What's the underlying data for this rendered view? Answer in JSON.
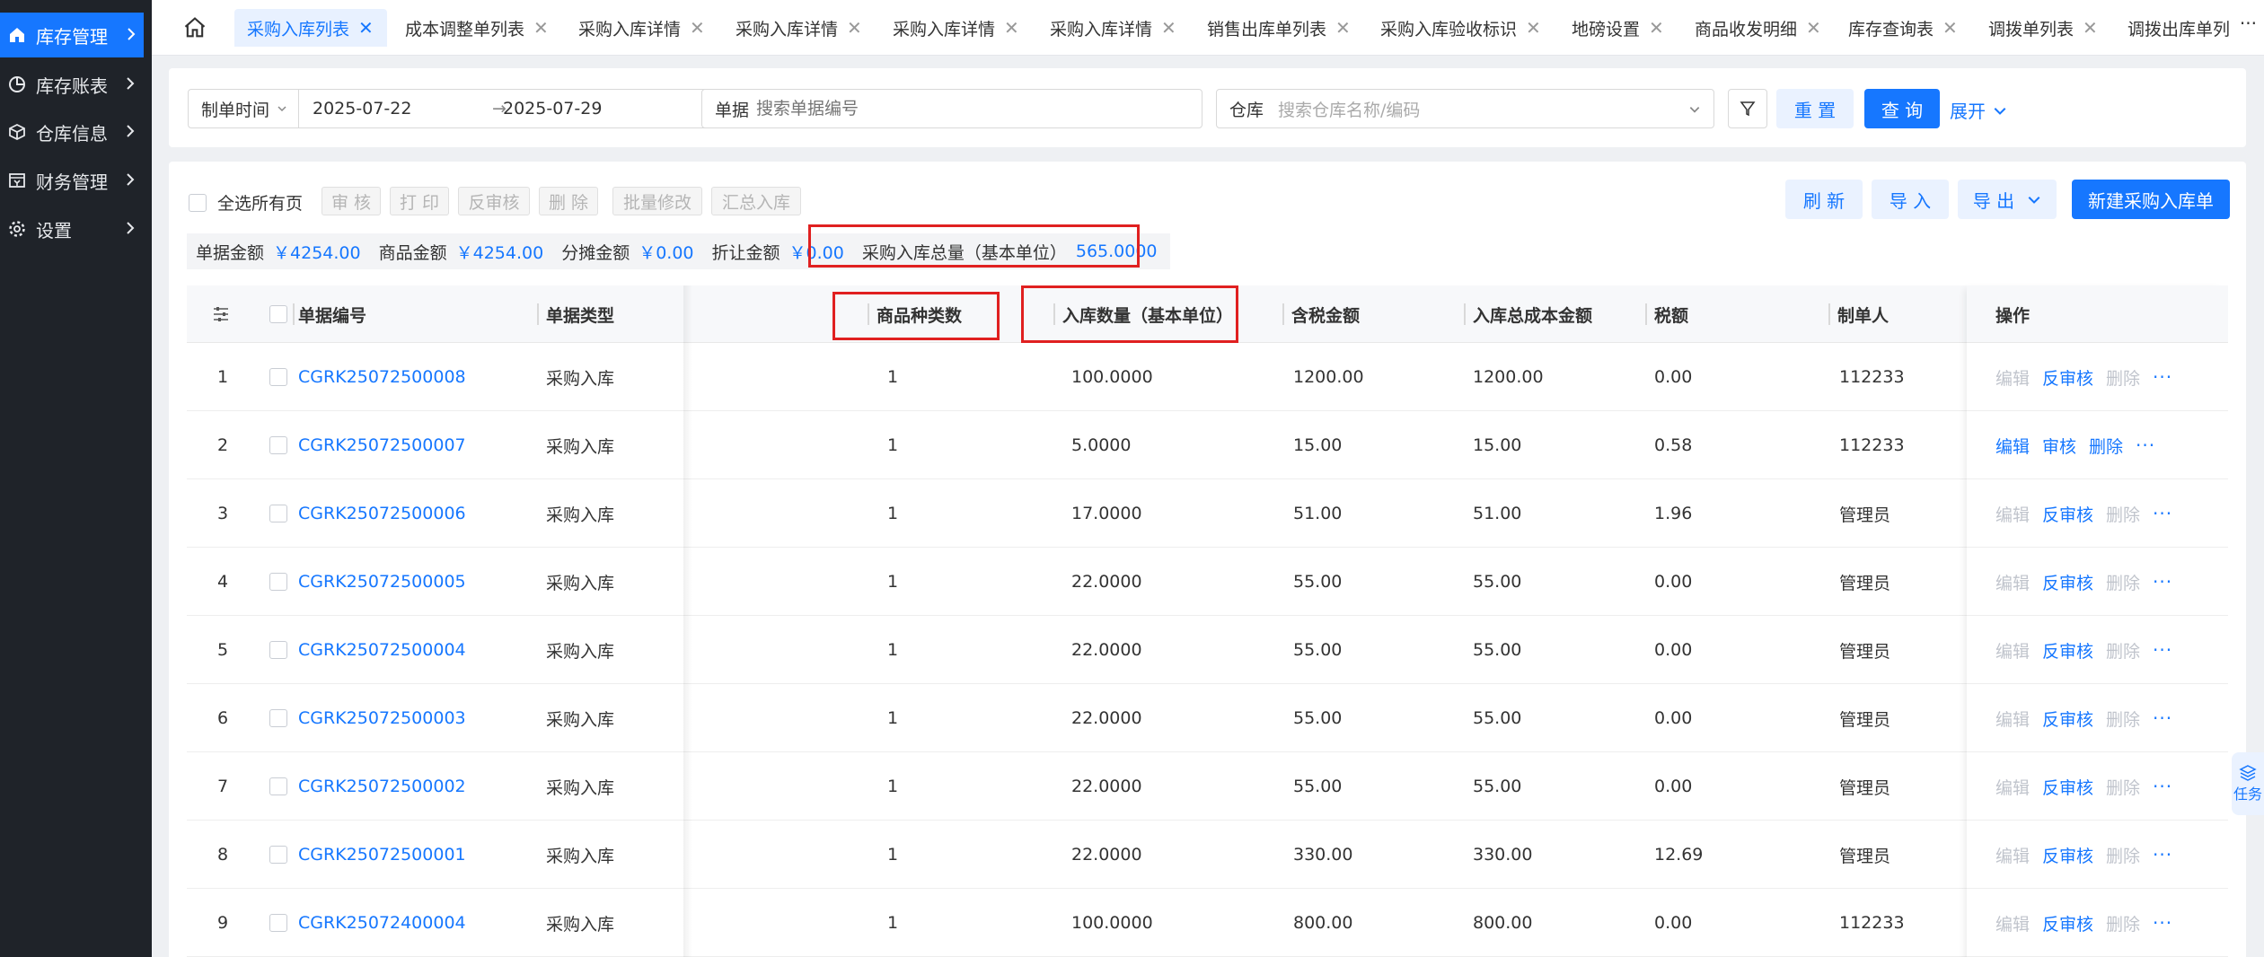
{
  "sidebar": {
    "items": [
      {
        "label": "库存管理",
        "icon": "home-icon",
        "active": true
      },
      {
        "label": "库存账表",
        "icon": "pie-chart-icon"
      },
      {
        "label": "仓库信息",
        "icon": "cube-icon"
      },
      {
        "label": "财务管理",
        "icon": "finance-icon"
      },
      {
        "label": "设置",
        "icon": "gear-icon"
      }
    ]
  },
  "tabs": [
    {
      "label": "采购入库列表",
      "active": true
    },
    {
      "label": "成本调整单列表"
    },
    {
      "label": "采购入库详情"
    },
    {
      "label": "采购入库详情"
    },
    {
      "label": "采购入库详情"
    },
    {
      "label": "采购入库详情"
    },
    {
      "label": "销售出库单列表"
    },
    {
      "label": "采购入库验收标识"
    },
    {
      "label": "地磅设置"
    },
    {
      "label": "商品收发明细"
    },
    {
      "label": "库存查询表"
    },
    {
      "label": "调拨单列表"
    },
    {
      "label": "调拨出库单列"
    }
  ],
  "tab_more": "···",
  "filters": {
    "date_type": "制单时间",
    "date_start": "2025-07-22",
    "date_end": "2025-07-29",
    "date_arrow": "→",
    "doc_label": "单据",
    "doc_placeholder": "搜索单据编号",
    "warehouse_label": "仓库",
    "warehouse_placeholder": "搜索仓库名称/编码",
    "reset": "重 置",
    "query": "查 询",
    "expand": "展开"
  },
  "toolbar": {
    "select_all": "全选所有页",
    "audit": "审 核",
    "print": "打 印",
    "unaudit": "反审核",
    "delete": "删 除",
    "batch_edit": "批量修改",
    "summary_in": "汇总入库",
    "refresh": "刷 新",
    "import": "导 入",
    "export": "导 出",
    "new_order": "新建采购入库单"
  },
  "summary": {
    "doc_amount_label": "单据金额",
    "doc_amount": "￥4254.00",
    "goods_amount_label": "商品金额",
    "goods_amount": "￥4254.00",
    "share_amount_label": "分摊金额",
    "share_amount": "￥0.00",
    "discount_label": "折让金额",
    "discount": "￥0.00",
    "total_qty_label": "采购入库总量（基本单位）",
    "total_qty": "565.0000"
  },
  "table": {
    "columns": {
      "doc_no": "单据编号",
      "doc_type": "单据类型",
      "kinds": "商品种类数",
      "qty": "入库数量（基本单位）",
      "tax_amount": "含税金额",
      "cost": "入库总成本金额",
      "tax": "税额",
      "maker": "制单人",
      "ops": "操作"
    },
    "rows": [
      {
        "idx": "1",
        "no": "CGRK25072500008",
        "type": "采购入库",
        "kinds": "1",
        "qty": "100.0000",
        "amt": "1200.00",
        "cost": "1200.00",
        "tax": "0.00",
        "maker": "112233",
        "audited": true
      },
      {
        "idx": "2",
        "no": "CGRK25072500007",
        "type": "采购入库",
        "kinds": "1",
        "qty": "5.0000",
        "amt": "15.00",
        "cost": "15.00",
        "tax": "0.58",
        "maker": "112233",
        "audited": false
      },
      {
        "idx": "3",
        "no": "CGRK25072500006",
        "type": "采购入库",
        "kinds": "1",
        "qty": "17.0000",
        "amt": "51.00",
        "cost": "51.00",
        "tax": "1.96",
        "maker": "管理员",
        "audited": true
      },
      {
        "idx": "4",
        "no": "CGRK25072500005",
        "type": "采购入库",
        "kinds": "1",
        "qty": "22.0000",
        "amt": "55.00",
        "cost": "55.00",
        "tax": "0.00",
        "maker": "管理员",
        "audited": true
      },
      {
        "idx": "5",
        "no": "CGRK25072500004",
        "type": "采购入库",
        "kinds": "1",
        "qty": "22.0000",
        "amt": "55.00",
        "cost": "55.00",
        "tax": "0.00",
        "maker": "管理员",
        "audited": true
      },
      {
        "idx": "6",
        "no": "CGRK25072500003",
        "type": "采购入库",
        "kinds": "1",
        "qty": "22.0000",
        "amt": "55.00",
        "cost": "55.00",
        "tax": "0.00",
        "maker": "管理员",
        "audited": true
      },
      {
        "idx": "7",
        "no": "CGRK25072500002",
        "type": "采购入库",
        "kinds": "1",
        "qty": "22.0000",
        "amt": "55.00",
        "cost": "55.00",
        "tax": "0.00",
        "maker": "管理员",
        "audited": true
      },
      {
        "idx": "8",
        "no": "CGRK25072500001",
        "type": "采购入库",
        "kinds": "1",
        "qty": "22.0000",
        "amt": "330.00",
        "cost": "330.00",
        "tax": "12.69",
        "maker": "管理员",
        "audited": true
      },
      {
        "idx": "9",
        "no": "CGRK25072400004",
        "type": "采购入库",
        "kinds": "1",
        "qty": "100.0000",
        "amt": "800.00",
        "cost": "800.00",
        "tax": "0.00",
        "maker": "112233",
        "audited": true
      }
    ],
    "ops_audited": [
      "编辑",
      "反审核",
      "删除"
    ],
    "ops_pending": [
      "编辑",
      "审核",
      "删除"
    ],
    "ops_more": "···"
  },
  "float_task": "任务",
  "colors": {
    "primary": "#1677ff",
    "sidebar": "#1f2329",
    "highlight": "#e02020"
  }
}
